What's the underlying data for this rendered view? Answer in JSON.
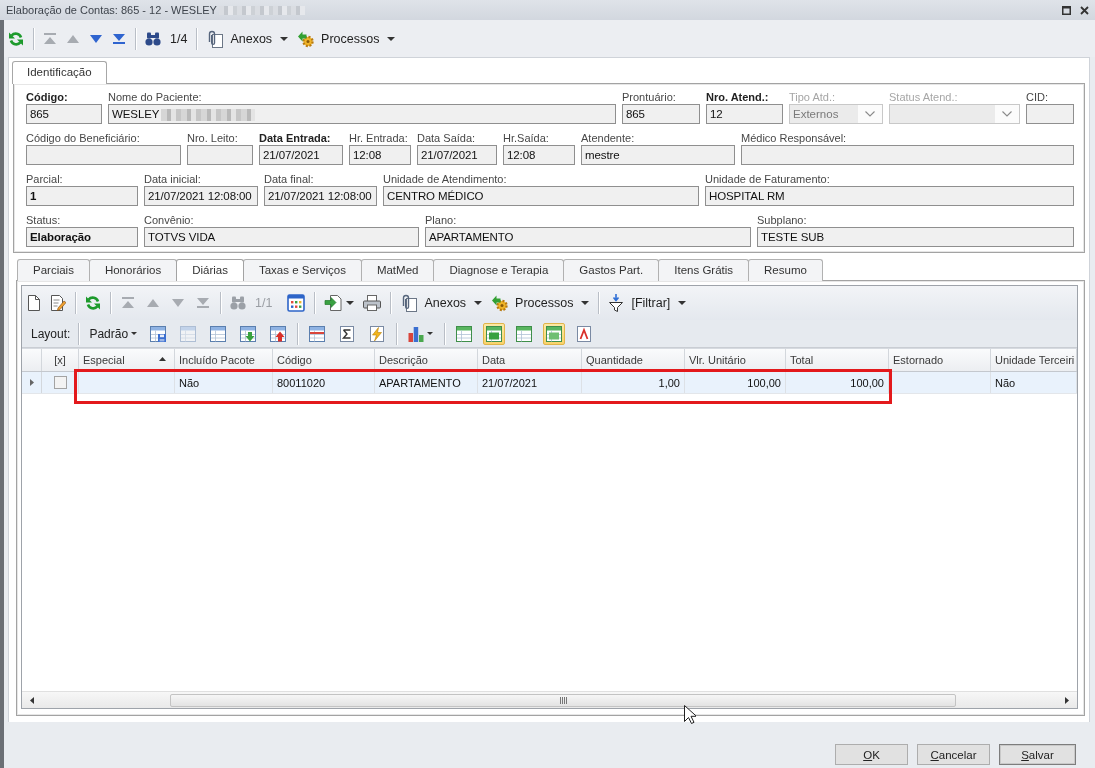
{
  "window": {
    "title": "Elaboração de Contas: 865 - 12 - WESLEY",
    "title_redacted": true
  },
  "toolbar": {
    "navigation": [
      {
        "disabled": true
      },
      {
        "disabled": true
      },
      {
        "disabled": false
      },
      {
        "disabled": false
      }
    ],
    "record_position": {
      "text": "1/4",
      "disabled": false
    },
    "menus": [
      "Anexos",
      "Processos"
    ]
  },
  "top_tabs": [
    {
      "label": "Identificação",
      "selected": true
    }
  ],
  "form": {
    "rows": [
      [
        {
          "label": "Código:",
          "value": "865",
          "kind": "text",
          "label_bold": true,
          "value_bold": false,
          "disabled": false,
          "redacted": false
        },
        {
          "label": "Nome do Paciente:",
          "value": "WESLEY",
          "kind": "text",
          "label_bold": false,
          "value_bold": false,
          "disabled": false,
          "redacted": true
        },
        {
          "label": "Prontuário:",
          "value": "865",
          "kind": "text",
          "label_bold": false,
          "value_bold": false,
          "disabled": false,
          "redacted": false
        },
        {
          "label": "Nro. Atend.:",
          "value": "12",
          "kind": "text",
          "label_bold": true,
          "value_bold": false,
          "disabled": false,
          "redacted": false
        },
        {
          "label": "Tipo Atd.:",
          "value": "Externos",
          "kind": "combo",
          "label_bold": false,
          "value_bold": false,
          "disabled": true,
          "redacted": false
        },
        {
          "label": "Status Atend.:",
          "kind": "combo",
          "label_bold": false,
          "disabled": true,
          "redacted": false
        },
        {
          "label": "CID:",
          "kind": "text",
          "label_bold": false,
          "disabled": false,
          "redacted": false
        }
      ],
      [
        {
          "label": "Código do Beneficiário:",
          "kind": "text",
          "label_bold": false,
          "disabled": false,
          "redacted": false
        },
        {
          "label": "Nro. Leito:",
          "kind": "text",
          "label_bold": false,
          "disabled": false,
          "redacted": false
        },
        {
          "label": "Data Entrada:",
          "value": "21/07/2021",
          "kind": "text",
          "label_bold": true,
          "value_bold": false,
          "disabled": false,
          "redacted": false
        },
        {
          "label": "Hr. Entrada:",
          "value": "12:08",
          "kind": "text",
          "label_bold": false,
          "value_bold": false,
          "disabled": false,
          "redacted": false
        },
        {
          "label": "Data Saída:",
          "value": "21/07/2021",
          "kind": "text",
          "label_bold": false,
          "value_bold": false,
          "disabled": false,
          "redacted": false
        },
        {
          "label": "Hr.Saída:",
          "value": "12:08",
          "kind": "text",
          "label_bold": false,
          "value_bold": false,
          "disabled": false,
          "redacted": false
        },
        {
          "label": "Atendente:",
          "value": "mestre",
          "kind": "text",
          "label_bold": false,
          "value_bold": false,
          "disabled": false,
          "redacted": false
        },
        {
          "label": "Médico Responsável:",
          "kind": "text",
          "label_bold": false,
          "disabled": false,
          "redacted": false
        }
      ],
      [
        {
          "label": "Parcial:",
          "value": "1",
          "kind": "text",
          "label_bold": false,
          "value_bold": true,
          "disabled": false,
          "redacted": false
        },
        {
          "label": "Data inicial:",
          "value": "21/07/2021 12:08:00",
          "kind": "text",
          "label_bold": false,
          "value_bold": false,
          "disabled": false,
          "redacted": false
        },
        {
          "label": "Data final:",
          "value": "21/07/2021 12:08:00",
          "kind": "text",
          "label_bold": false,
          "value_bold": false,
          "disabled": false,
          "redacted": false
        },
        {
          "label": "Unidade de Atendimento:",
          "value": "CENTRO MÉDICO",
          "kind": "text",
          "label_bold": false,
          "value_bold": false,
          "disabled": false,
          "redacted": false
        },
        {
          "label": "Unidade de Faturamento:",
          "value": "HOSPITAL RM",
          "kind": "text",
          "label_bold": false,
          "value_bold": false,
          "disabled": false,
          "redacted": false
        }
      ],
      [
        {
          "label": "Status:",
          "value": "Elaboração",
          "kind": "text",
          "label_bold": false,
          "value_bold": true,
          "disabled": false,
          "redacted": false
        },
        {
          "label": "Convênio:",
          "value": "TOTVS VIDA",
          "kind": "text",
          "label_bold": false,
          "value_bold": false,
          "disabled": false,
          "redacted": false
        },
        {
          "label": "Plano:",
          "value": "APARTAMENTO",
          "kind": "text",
          "label_bold": false,
          "value_bold": false,
          "disabled": false,
          "redacted": false
        },
        {
          "label": "Subplano:",
          "value": "TESTE SUB",
          "kind": "text",
          "label_bold": false,
          "value_bold": false,
          "disabled": false,
          "redacted": false
        }
      ]
    ]
  },
  "tabs": [
    {
      "label": "Parciais",
      "selected": false
    },
    {
      "label": "Honorários",
      "selected": false
    },
    {
      "label": "Diárias",
      "selected": true
    },
    {
      "label": "Taxas e Serviços",
      "selected": false
    },
    {
      "label": "MatMed",
      "selected": false
    },
    {
      "label": "Diagnose e Terapia",
      "selected": false
    },
    {
      "label": "Gastos Part.",
      "selected": false
    },
    {
      "label": "Itens Grátis",
      "selected": false
    },
    {
      "label": "Resumo",
      "selected": false
    }
  ],
  "grid": {
    "toolbar": {
      "navigation": [
        {
          "disabled": true
        },
        {
          "disabled": true
        },
        {
          "disabled": true
        },
        {
          "disabled": true
        }
      ],
      "record_position": {
        "text": "1/1",
        "disabled": true
      },
      "menus": [
        "Anexos",
        "Processos",
        "[Filtrar]"
      ]
    },
    "layout_bar": {
      "label": "Layout:",
      "preset": "Padrão",
      "tools": [
        [
          {
            "disabled": false,
            "pressed": false,
            "menu": false
          },
          {
            "disabled": true,
            "pressed": false,
            "menu": false
          },
          {
            "disabled": false,
            "pressed": false,
            "menu": false
          },
          {
            "disabled": false,
            "pressed": false,
            "menu": false
          },
          {
            "disabled": false,
            "pressed": false,
            "menu": false
          }
        ],
        [
          {
            "disabled": false,
            "pressed": false,
            "menu": false
          },
          {
            "disabled": false,
            "pressed": false,
            "menu": false
          },
          {
            "disabled": false,
            "pressed": false,
            "menu": false
          }
        ],
        [
          {
            "disabled": false,
            "pressed": false,
            "menu": true
          }
        ],
        [
          {
            "disabled": false,
            "pressed": false,
            "menu": false
          },
          {
            "disabled": false,
            "pressed": true,
            "menu": false
          },
          {
            "disabled": false,
            "pressed": false,
            "menu": false
          },
          {
            "disabled": false,
            "pressed": true,
            "menu": false
          },
          {
            "disabled": false,
            "pressed": false,
            "menu": false
          }
        ]
      ]
    },
    "columns": [
      {
        "label": "[x]",
        "kind": "check",
        "sorted": false
      },
      {
        "label": "Especial",
        "kind": "text",
        "sorted": true
      },
      {
        "label": "Incluído Pacote",
        "kind": "text",
        "sorted": false
      },
      {
        "label": "Código",
        "kind": "text",
        "sorted": false
      },
      {
        "label": "Descrição",
        "kind": "text",
        "sorted": false
      },
      {
        "label": "Data",
        "kind": "text",
        "sorted": false
      },
      {
        "label": "Quantidade",
        "kind": "number",
        "sorted": false
      },
      {
        "label": "Vlr. Unitário",
        "kind": "number",
        "sorted": false
      },
      {
        "label": "Total",
        "kind": "number",
        "sorted": false
      },
      {
        "label": "Estornado",
        "kind": "text",
        "sorted": false
      },
      {
        "label": "Unidade Terceiri",
        "kind": "text",
        "sorted": false
      }
    ],
    "rows": [
      {
        "selected": true,
        "checked": false,
        "highlighted": true,
        "cells": [
          null,
          null,
          "Não",
          "80011020",
          "APARTAMENTO",
          "21/07/2021",
          "1,00",
          "100,00",
          "100,00",
          null,
          "Não"
        ]
      }
    ]
  },
  "buttons": [
    {
      "label": "OK",
      "default": false
    },
    {
      "label": "Cancelar",
      "default": false
    },
    {
      "label": "Salvar",
      "default": true
    }
  ]
}
